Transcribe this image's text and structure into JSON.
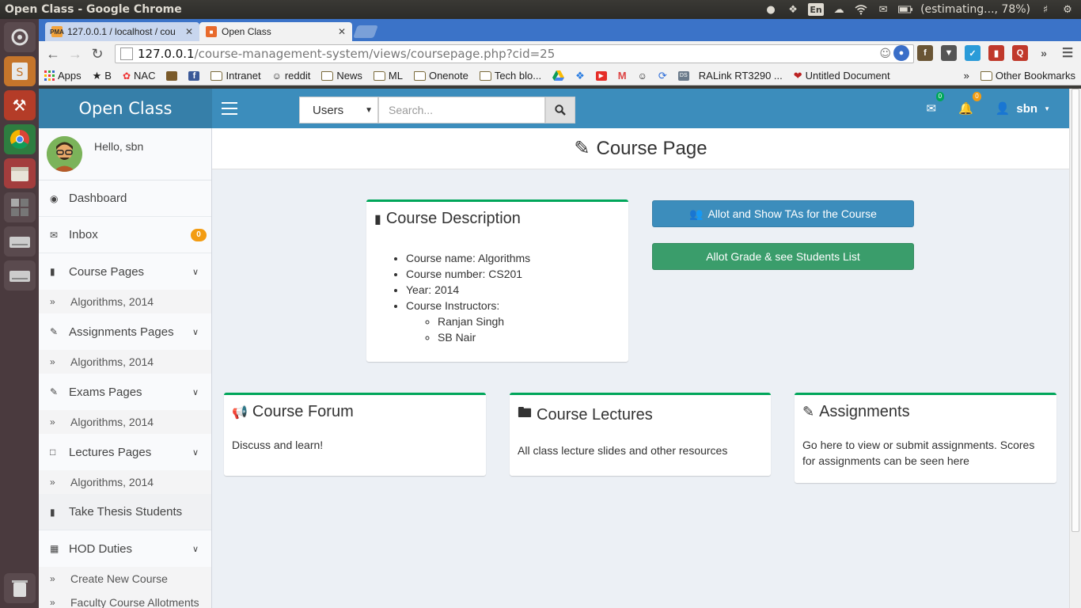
{
  "os_panel": {
    "window_title": "Open Class - Google Chrome",
    "keyboard_layout": "En",
    "battery_text": "(estimating..., 78%)"
  },
  "launcher": {
    "items": [
      "dash-icon",
      "sublime-icon",
      "settings-icon",
      "chrome-icon",
      "files-icon",
      "workspace-icon",
      "drive-icon",
      "drive-icon",
      "trash-icon"
    ]
  },
  "browser": {
    "tabs": [
      {
        "title": "127.0.0.1 / localhost / cou",
        "favicon_text": "PMA",
        "active": false
      },
      {
        "title": "Open Class",
        "favicon_text": "OC",
        "active": true
      }
    ],
    "url_host": "127.0.0.1",
    "url_path": "/course-management-system/views/coursepage.php?cid=25",
    "bookmarks": [
      {
        "label": "Apps",
        "icon": "apps-grid-icon"
      },
      {
        "label": "B",
        "icon": "star-icon"
      },
      {
        "label": "NAC",
        "icon": "nac-icon"
      },
      {
        "label": "",
        "icon": "app-icon"
      },
      {
        "label": "",
        "icon": "facebook-icon"
      },
      {
        "label": "Intranet",
        "icon": "folder-icon"
      },
      {
        "label": "reddit",
        "icon": "reddit-icon"
      },
      {
        "label": "News",
        "icon": "folder-icon"
      },
      {
        "label": "ML",
        "icon": "folder-icon"
      },
      {
        "label": "Onenote",
        "icon": "folder-icon"
      },
      {
        "label": "Tech blo...",
        "icon": "folder-icon"
      },
      {
        "label": "",
        "icon": "drive-icon"
      },
      {
        "label": "",
        "icon": "dropbox-icon"
      },
      {
        "label": "",
        "icon": "youtube-icon"
      },
      {
        "label": "",
        "icon": "gmail-icon"
      },
      {
        "label": "",
        "icon": "reddit-icon"
      },
      {
        "label": "",
        "icon": "refresh-app-icon"
      },
      {
        "label": "RALink RT3290 ...",
        "icon": "ds-icon"
      },
      {
        "label": "Untitled Document",
        "icon": "untitled-icon"
      }
    ],
    "bookmarks_overflow": "»",
    "other_bookmarks": "Other Bookmarks"
  },
  "app": {
    "logo": "Open Class",
    "search": {
      "select_value": "Users",
      "placeholder": "Search..."
    },
    "messages_count": "0",
    "notifications_count": "0",
    "username": "sbn",
    "colors": {
      "navbar": "#3c8dbc",
      "logo_bg": "#367fa9",
      "box_accent": "#00a65a",
      "btn_primary": "#3c8dbc",
      "btn_success": "#3a9d6b",
      "badge": "#f39c12"
    }
  },
  "sidebar": {
    "greeting": "Hello, sbn",
    "items": [
      {
        "label": "Dashboard",
        "icon": "dashboard-icon"
      },
      {
        "label": "Inbox",
        "icon": "envelope-icon",
        "badge": "0"
      },
      {
        "label": "Course Pages",
        "icon": "book-icon",
        "sub": "Algorithms, 2014"
      },
      {
        "label": "Assignments Pages",
        "icon": "edit-icon",
        "sub": "Algorithms, 2014"
      },
      {
        "label": "Exams Pages",
        "icon": "edit-icon",
        "sub": "Algorithms, 2014"
      },
      {
        "label": "Lectures Pages",
        "icon": "folder-icon",
        "sub": "Algorithms, 2014"
      },
      {
        "label": "Take Thesis Students",
        "icon": "book-icon"
      },
      {
        "label": "HOD Duties",
        "icon": "table-icon"
      }
    ],
    "hod_subitems": [
      "Create New Course",
      "Faculty Course Allotments"
    ]
  },
  "main": {
    "page_title": "Course Page",
    "description": {
      "title": "Course Description",
      "course_name": "Course name: Algorithms",
      "course_number": "Course number: CS201",
      "year": "Year: 2014",
      "instructors_label": "Course Instructors:",
      "instructors": [
        "Ranjan Singh",
        "SB Nair"
      ]
    },
    "buttons": {
      "allot_tas": "Allot and Show TAs for the Course",
      "allot_grade": "Allot Grade & see Students List"
    },
    "cards": [
      {
        "title": "Course Forum",
        "text": "Discuss and learn!"
      },
      {
        "title": "Course Lectures",
        "text": "All class lecture slides and other resources"
      },
      {
        "title": "Assignments",
        "text": "Go here to view or submit assignments. Scores for assignments can be seen here"
      }
    ]
  }
}
